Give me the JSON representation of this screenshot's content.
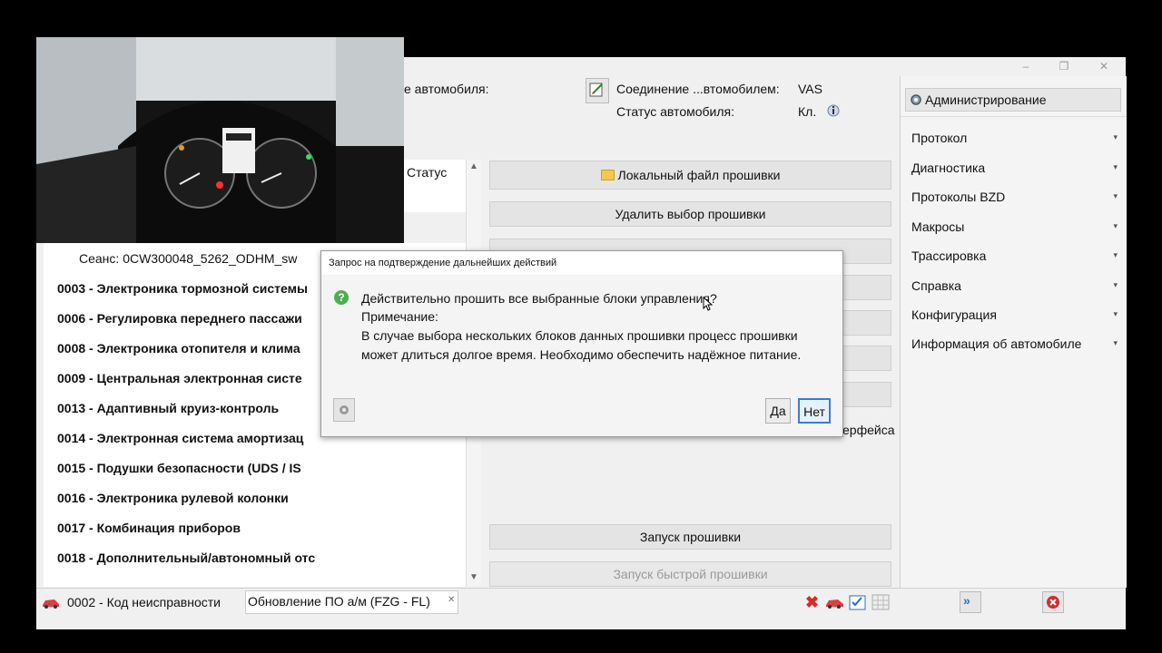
{
  "top": {
    "vehicle_label_partial": "е автомобиля:",
    "connection_label": "Соединение ...втомобилем:",
    "connection_value": "VAS",
    "status_label": "Статус автомобиля:",
    "status_value": "Кл."
  },
  "left_panel": {
    "status_header": "Статус",
    "session": "Сеанс: 0CW300048_5262_ODHM_sw",
    "ecus": [
      "0003 - Электроника тормозной системы",
      "0006 - Регулировка переднего пассажи",
      "0008 - Электроника отопителя и клима",
      "0009 - Центральная электронная систе",
      "0013 - Адаптивный круиз-контроль",
      "0014 - Электронная система амортизац",
      "0015 - Подушки безопасности   (UDS / IS",
      "0016 - Электроника рулевой колонки",
      "0017 - Комбинация приборов",
      "0018 - Дополнительный/автономный отс"
    ]
  },
  "center": {
    "local_file_btn": "Локальный файл прошивки",
    "delete_selection_btn": "Удалить выбор прошивки",
    "interface_partial": "ерфейса",
    "start_flash_btn": "Запуск прошивки",
    "start_fast_flash_btn": "Запуск быстрой прошивки"
  },
  "right_panel": {
    "admin": "Администрирование",
    "menu": [
      "Протокол",
      "Диагностика",
      "Протоколы BZD",
      "Макросы",
      "Трассировка",
      "Справка",
      "Конфигурация",
      "Информация об автомобиле"
    ]
  },
  "dialog": {
    "title": "Запрос на подтверждение дальнейших действий",
    "question": "Действительно прошить все выбранные блоки управления?",
    "note_label": "Примечание:",
    "note_line1": "В случае выбора нескольких блоков данных прошивки процесс прошивки",
    "note_line2": "может длиться долгое время. Необходимо обеспечить надёжное питание.",
    "yes": "Да",
    "no": "Нет"
  },
  "bottom": {
    "tab1": "0002 - Код неисправности",
    "tab2": "Обновление ПО а/м (FZG - FL)"
  },
  "window_controls": [
    "–",
    "❐",
    "✕"
  ],
  "colors": {
    "accent_blue": "#3a7bd5",
    "error_red": "#d62b2b",
    "ok_green": "#4caf50"
  }
}
